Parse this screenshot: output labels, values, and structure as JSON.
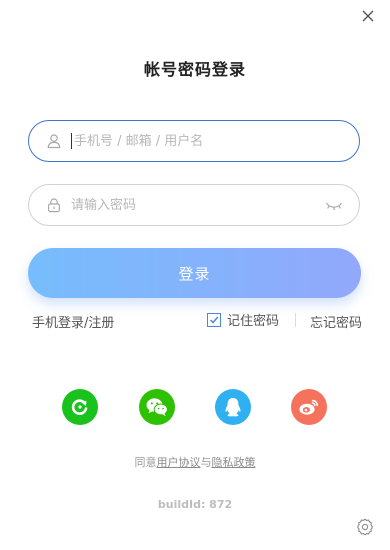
{
  "window": {
    "title": "帐号密码登录",
    "close_icon": "close-icon",
    "settings_icon": "gear-icon"
  },
  "form": {
    "username": {
      "icon": "user-icon",
      "placeholder": "手机号 / 邮箱 / 用户名",
      "value": ""
    },
    "password": {
      "icon": "lock-icon",
      "placeholder": "请输入密码",
      "value": "",
      "toggle_icon": "eye-closed-icon"
    },
    "login_label": "登录",
    "phone_login_label": "手机登录/注册",
    "remember_label": "记住密码",
    "remember_checked": true,
    "forgot_label": "忘记密码"
  },
  "social": [
    {
      "name": "wechat-green-app",
      "icon": "refresh-arrow-icon",
      "color": "#19c21d"
    },
    {
      "name": "wechat",
      "icon": "wechat-icon",
      "color": "#2dc100"
    },
    {
      "name": "qq",
      "icon": "qq-penguin-icon",
      "color": "#2fb0f0"
    },
    {
      "name": "weibo",
      "icon": "weibo-icon",
      "color": "#f5725d"
    }
  ],
  "agreement": {
    "prefix": "同意",
    "user_agreement": "用户协议",
    "conjunction": "与",
    "privacy_policy": "隐私政策"
  },
  "build": {
    "text": "buildId: 872"
  },
  "colors": {
    "accent": "#3f74c9",
    "button_gradient_start": "#76bdfc",
    "button_gradient_end": "#92a8fb"
  }
}
